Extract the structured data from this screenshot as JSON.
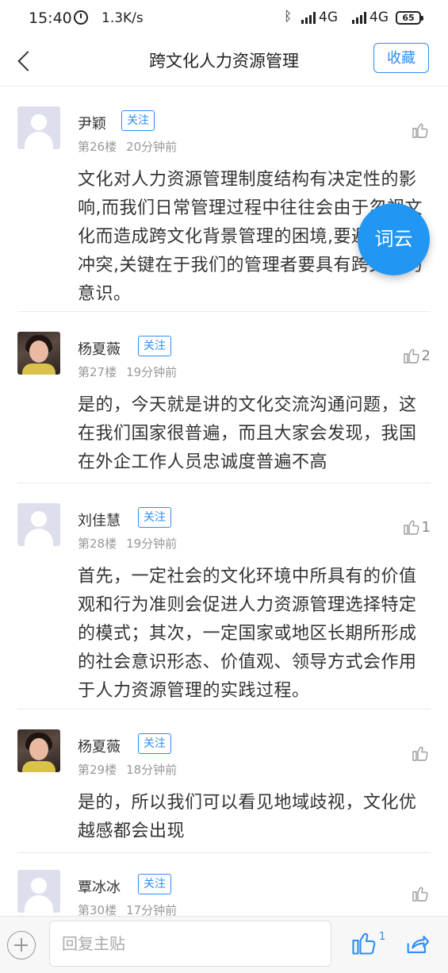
{
  "status_bar": {
    "time": "15:40",
    "speed": "1.3K/s",
    "network1": "4G",
    "network2": "4G",
    "battery": "65"
  },
  "header": {
    "title": "跨文化人力资源管理",
    "collect_label": "收藏"
  },
  "floating_button": "词云",
  "comments": [
    {
      "name": "尹颖",
      "follow": "关注",
      "floor": "第26楼",
      "time": "20分钟前",
      "likes": "",
      "avatar": "default",
      "content": "文化对人力资源管理制度结构有决定性的影响,而我们日常管理过程中往往会由于忽视文化而造成跨文化背景管理的困境,要避免这种冲突,关键在于我们的管理者要具有跨文化的意识。"
    },
    {
      "name": "杨夏薇",
      "follow": "关注",
      "floor": "第27楼",
      "time": "19分钟前",
      "likes": "2",
      "avatar": "photo",
      "content": "是的，今天就是讲的文化交流沟通问题，这在我们国家很普遍，而且大家会发现，我国在外企工作人员忠诚度普遍不高"
    },
    {
      "name": "刘佳慧",
      "follow": "关注",
      "floor": "第28楼",
      "time": "19分钟前",
      "likes": "1",
      "avatar": "default",
      "content": "首先，一定社会的文化环境中所具有的价值观和行为准则会促进人力资源管理选择特定的模式；其次，一定国家或地区长期所形成的社会意识形态、价值观、领导方式会作用于人力资源管理的实践过程。"
    },
    {
      "name": "杨夏薇",
      "follow": "关注",
      "floor": "第29楼",
      "time": "18分钟前",
      "likes": "",
      "avatar": "photo",
      "content": "是的，所以我们可以看见地域歧视，文化优越感都会出现"
    },
    {
      "name": "覃冰冰",
      "follow": "关注",
      "floor": "第30楼",
      "time": "17分钟前",
      "likes": "",
      "avatar": "default",
      "content": ""
    }
  ],
  "bottom_bar": {
    "reply_placeholder": "回复主贴",
    "like_count": "1"
  }
}
